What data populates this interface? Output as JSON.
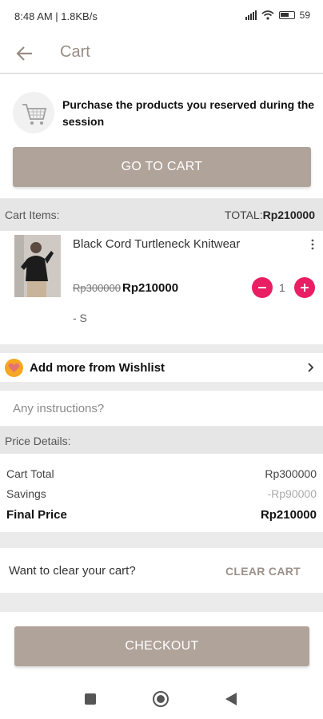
{
  "status_bar": {
    "time": "8:48 AM | 1.8KB/s",
    "battery": "59"
  },
  "appbar": {
    "title": "Cart",
    "back_icon": "arrow-left-icon"
  },
  "promo": {
    "message": "Purchase the products you reserved during the session",
    "button_label": "GO TO CART",
    "icon": "shopping-cart-icon"
  },
  "cart_items": {
    "label": "Cart Items:",
    "total_label": "TOTAL:",
    "total_value": "Rp210000",
    "items": [
      {
        "name": "Black Cord Turtleneck Knitwear",
        "original_price": "Rp300000",
        "price": "Rp210000",
        "quantity": "1",
        "variant": "- S"
      }
    ]
  },
  "wishlist": {
    "label": "Add more from Wishlist"
  },
  "instructions": {
    "placeholder": "Any instructions?"
  },
  "price_details": {
    "label": "Price Details:",
    "cart_total_label": "Cart Total",
    "cart_total_value": "Rp300000",
    "savings_label": "Savings",
    "savings_value": "-Rp90000",
    "final_label": "Final Price",
    "final_value": "Rp210000"
  },
  "clear_cart": {
    "label": "Want to clear your cart?",
    "button_label": "CLEAR CART"
  },
  "checkout": {
    "label": "CHECKOUT"
  },
  "colors": {
    "brand": "#b0a39a",
    "accent": "#e91e63",
    "background": "#ebebeb"
  }
}
